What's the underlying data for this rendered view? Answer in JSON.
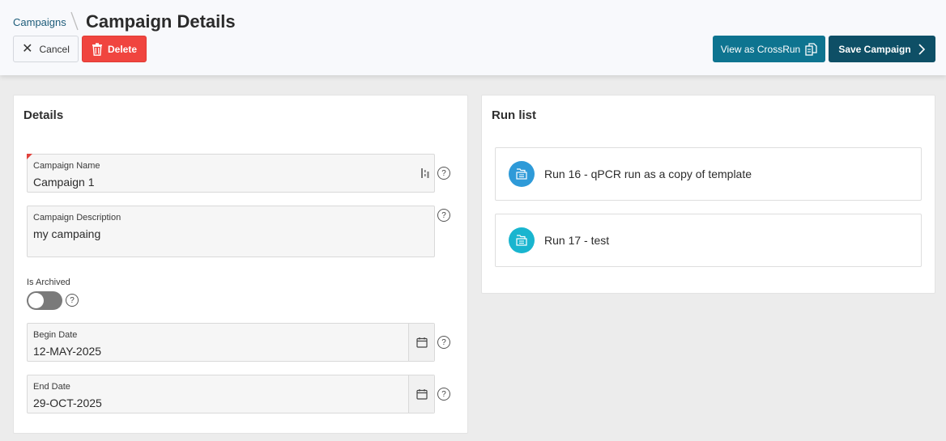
{
  "header": {
    "breadcrumb_link": "Campaigns",
    "title": "Campaign Details",
    "cancel_label": "Cancel",
    "delete_label": "Delete",
    "crossrun_label": "View as CrossRun",
    "save_label": "Save Campaign"
  },
  "details": {
    "title": "Details",
    "campaign_name": {
      "label": "Campaign Name",
      "value": "Campaign 1",
      "required": true
    },
    "campaign_description": {
      "label": "Campaign Description",
      "value": "my campaing"
    },
    "is_archived": {
      "label": "Is Archived",
      "value": false
    },
    "begin_date": {
      "label": "Begin Date",
      "value": "12-MAY-2025"
    },
    "end_date": {
      "label": "End Date",
      "value": "29-OCT-2025"
    }
  },
  "run_list": {
    "title": "Run list",
    "items": [
      {
        "label": "Run 16 - qPCR run as a copy of template",
        "color": "#2e9ad8",
        "icon": "run-icon"
      },
      {
        "label": "Run 17 - test",
        "color": "#19b5cf",
        "icon": "run-icon"
      }
    ]
  },
  "colors": {
    "primary": "#0e4f66",
    "secondary": "#0e7490",
    "danger": "#f0453f",
    "breadcrumb": "#1d5c7a"
  }
}
